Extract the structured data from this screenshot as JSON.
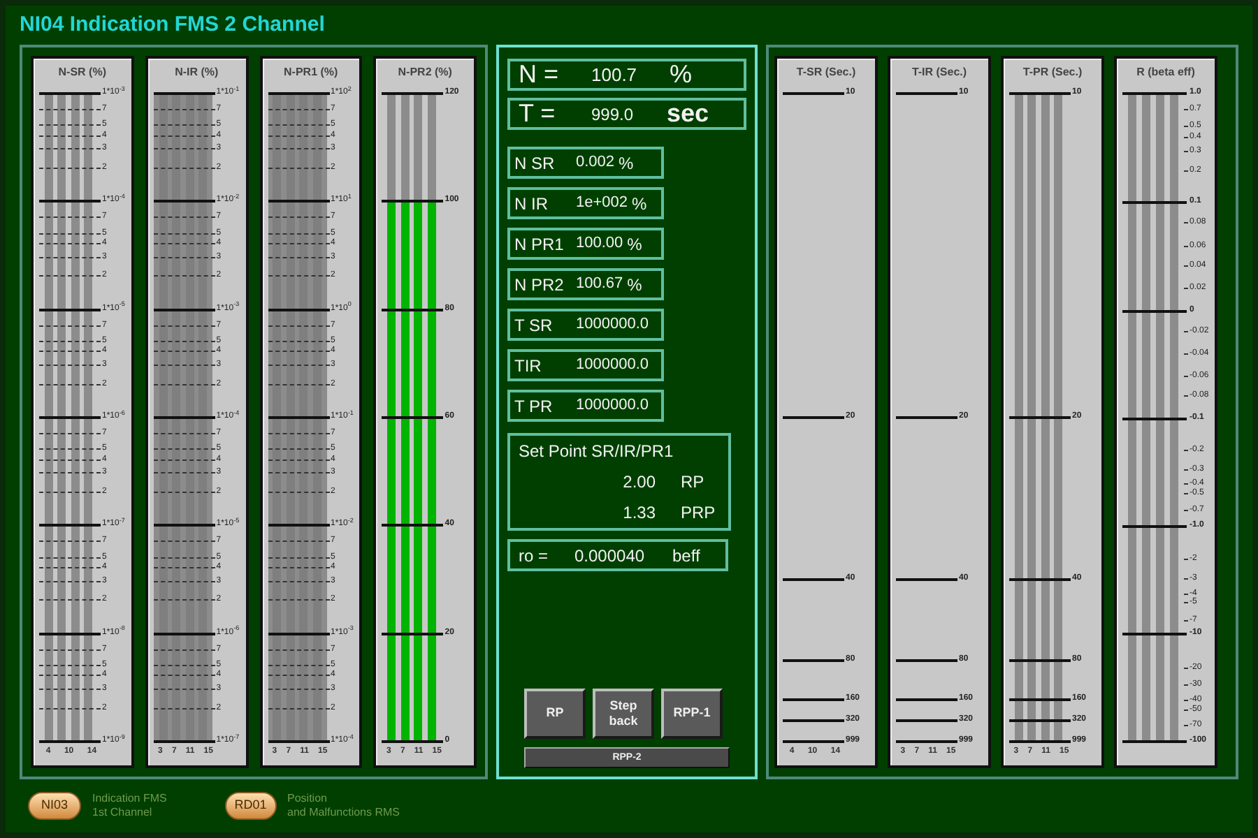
{
  "window": {
    "title": "NI04 Indication FMS 2 Channel"
  },
  "left_gauges": [
    {
      "title": "N-SR (%)",
      "kind": "log",
      "shaded": false,
      "bars": true,
      "channels": [
        "4",
        "10",
        "14"
      ],
      "scale": [
        "1*10$^{-3}$",
        "7",
        "5",
        "4",
        "3",
        "2",
        "1*10$^{-4}$",
        "7",
        "5",
        "4",
        "3",
        "2",
        "1*10$^{-5}$",
        "7",
        "5",
        "4",
        "3",
        "2",
        "1*10$^{-6}$",
        "7",
        "5",
        "4",
        "3",
        "2",
        "1*10$^{-7}$",
        "7",
        "5",
        "4",
        "3",
        "2",
        "1*10$^{-8}$",
        "7",
        "5",
        "4",
        "3",
        "2",
        "1*10$^{-9}$"
      ]
    },
    {
      "title": "N-IR (%)",
      "kind": "log",
      "shaded": true,
      "bars": true,
      "channels": [
        "3",
        "7",
        "11",
        "15"
      ],
      "scale": [
        "1*10$^{-1}$",
        "7",
        "5",
        "4",
        "3",
        "2",
        "1*10$^{-2}$",
        "7",
        "5",
        "4",
        "3",
        "2",
        "1*10$^{-3}$",
        "7",
        "5",
        "4",
        "3",
        "2",
        "1*10$^{-4}$",
        "7",
        "5",
        "4",
        "3",
        "2",
        "1*10$^{-5}$",
        "7",
        "5",
        "4",
        "3",
        "2",
        "1*10$^{-6}$",
        "7",
        "5",
        "4",
        "3",
        "2",
        "1*10$^{-7}$"
      ]
    },
    {
      "title": "N-PR1 (%)",
      "kind": "log",
      "shaded": true,
      "bars": true,
      "channels": [
        "3",
        "7",
        "11",
        "15"
      ],
      "scale": [
        "1*10$^{2}$",
        "7",
        "5",
        "4",
        "3",
        "2",
        "1*10$^{1}$",
        "7",
        "5",
        "4",
        "3",
        "2",
        "1*10$^{0}$",
        "7",
        "5",
        "4",
        "3",
        "2",
        "1*10$^{-1}$",
        "7",
        "5",
        "4",
        "3",
        "2",
        "1*10$^{-2}$",
        "7",
        "5",
        "4",
        "3",
        "2",
        "1*10$^{-3}$",
        "7",
        "5",
        "4",
        "3",
        "2",
        "1*10$^{-4}$"
      ]
    },
    {
      "title": "N-PR2 (%)",
      "kind": "linear",
      "shaded": false,
      "bars": true,
      "level": 0.833,
      "channels": [
        "3",
        "7",
        "11",
        "15"
      ],
      "scale": [
        "120",
        "100",
        "80",
        "60",
        "40",
        "20",
        "0"
      ]
    }
  ],
  "readouts": {
    "n": {
      "label": "N =",
      "value": "100.7",
      "unit": "%"
    },
    "t": {
      "label": "T =",
      "value": "999.0",
      "unit": "sec"
    },
    "values": [
      {
        "label": "N SR",
        "value": "0.002",
        "unit": "%"
      },
      {
        "label": "N IR",
        "value": "1e+002",
        "unit": "%"
      },
      {
        "label": "N PR1",
        "value": "100.00",
        "unit": "%"
      },
      {
        "label": "N PR2",
        "value": "100.67",
        "unit": "%"
      },
      {
        "label": "T SR",
        "value": "1000000.0"
      },
      {
        "label": "TIR",
        "value": "1000000.0"
      },
      {
        "label": "T PR",
        "value": "1000000.0"
      }
    ],
    "set_point": {
      "title": "Set Point SR/IR/PR1",
      "rows": [
        {
          "value": "2.00",
          "unit": "RP"
        },
        {
          "value": "1.33",
          "unit": "PRP"
        }
      ]
    },
    "ro": {
      "label": "ro =",
      "value": "0.000040",
      "unit": "beff"
    }
  },
  "buttons": [
    "RP",
    "Step back",
    "RPP-1"
  ],
  "wide_button": "RPP-2",
  "right_gauges": [
    {
      "title": "T-SR (Sec.)",
      "kind": "time",
      "shaded": false,
      "bars": false,
      "channels": [
        "4",
        "10",
        "14"
      ],
      "scale": [
        "10",
        "20",
        "40",
        "80",
        "160",
        "320",
        "999"
      ]
    },
    {
      "title": "T-IR (Sec.)",
      "kind": "time",
      "shaded": false,
      "bars": false,
      "channels": [
        "3",
        "7",
        "11",
        "15"
      ],
      "scale": [
        "10",
        "20",
        "40",
        "80",
        "160",
        "320",
        "999"
      ]
    },
    {
      "title": "T-PR (Sec.)",
      "kind": "time",
      "shaded": false,
      "bars": true,
      "channels": [
        "3",
        "7",
        "11",
        "15"
      ],
      "scale": [
        "10",
        "20",
        "40",
        "80",
        "160",
        "320",
        "999"
      ]
    },
    {
      "title": "R (beta eff)",
      "kind": "reactivity",
      "shaded": false,
      "bars": true,
      "scale": [
        "1.0",
        "0.7",
        "0.5",
        "0.4",
        "0.3",
        "0.2",
        "0.1",
        "0.08",
        "0.06",
        "0.04",
        "0.02",
        "0",
        "-0.02",
        "-0.04",
        "-0.06",
        "-0.08",
        "-0.1",
        "-0.2",
        "-0.3",
        "-0.4",
        "-0.5",
        "-0.7",
        "-1.0",
        "-2",
        "-3",
        "-4",
        "-5",
        "-7",
        "-10",
        "-20",
        "-30",
        "-40",
        "-50",
        "-70",
        "-100"
      ]
    }
  ],
  "footer": [
    {
      "code": "NI03",
      "lines": [
        "Indication FMS",
        "1st Channel"
      ]
    },
    {
      "code": "RD01",
      "lines": [
        "Position",
        "and Malfunctions RMS"
      ]
    }
  ]
}
